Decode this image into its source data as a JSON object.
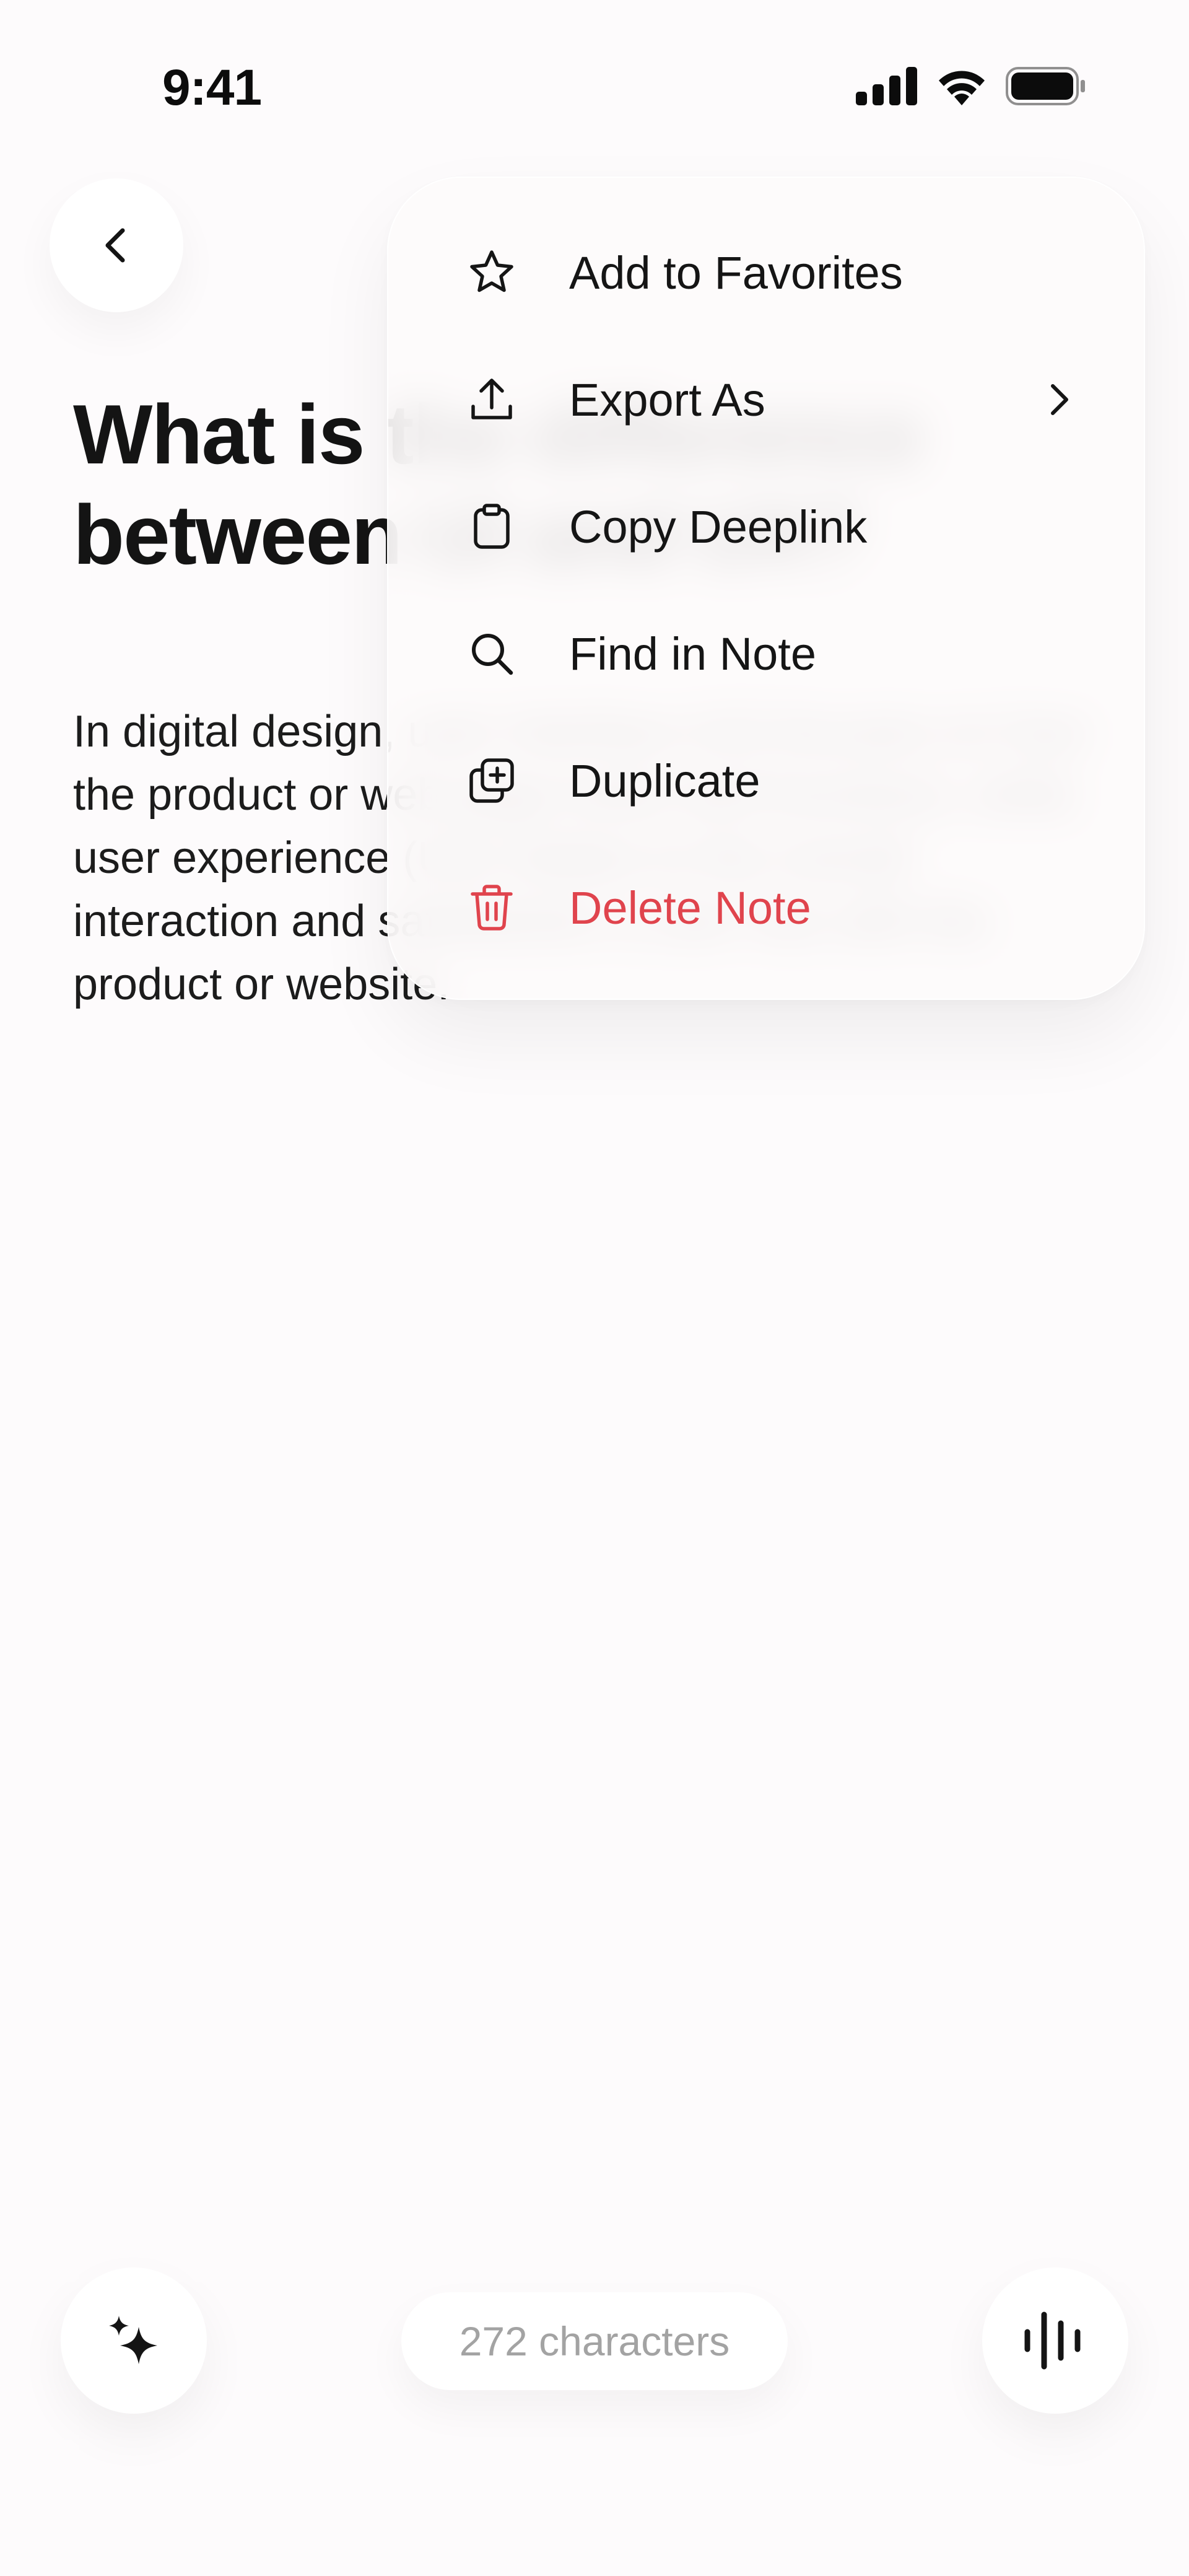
{
  "status_bar": {
    "time": "9:41",
    "icons": [
      "cellular-signal-icon",
      "wifi-icon",
      "battery-icon"
    ]
  },
  "header": {
    "back_icon": "chevron-left-icon"
  },
  "note": {
    "title_lines": [
      "What is the difference",
      "between UI and UX?"
    ],
    "body": "In digital design, user interface (UI) focuses on how the product or web page looks and functions, while user experience (UX) relates to the overall interaction and satisfaction a user has with the product or website."
  },
  "menu": {
    "items": [
      {
        "label": "Add to Favorites",
        "icon": "star-icon"
      },
      {
        "label": "Export As",
        "icon": "upload-icon",
        "has_submenu": true
      },
      {
        "label": "Copy Deeplink",
        "icon": "clipboard-icon"
      },
      {
        "label": "Find in Note",
        "icon": "search-icon"
      },
      {
        "label": "Duplicate",
        "icon": "duplicate-icon"
      },
      {
        "label": "Delete Note",
        "icon": "trash-icon",
        "destructive": true
      }
    ]
  },
  "bottom_bar": {
    "char_count": "272 characters",
    "left_button_icon": "sparkles-icon",
    "right_button_icon": "voice-waveform-icon"
  },
  "colors": {
    "background": "#fdfbfc",
    "text": "#151515",
    "destructive": "#e0444d",
    "muted": "#a3a3a3"
  }
}
